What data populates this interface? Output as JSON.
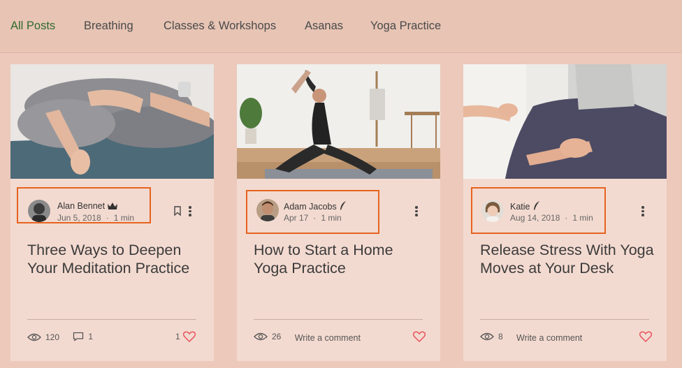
{
  "nav": {
    "tabs": [
      {
        "label": "All Posts",
        "active": true
      },
      {
        "label": "Breathing"
      },
      {
        "label": "Classes & Workshops"
      },
      {
        "label": "Asanas"
      },
      {
        "label": "Yoga Practice"
      }
    ]
  },
  "colors": {
    "accent_active_tab": "#2f6b2f",
    "highlight_box": "#e6631f",
    "heart": "#e8515b",
    "card_bg": "#f3dad0"
  },
  "posts": [
    {
      "author": "Alan Bennet",
      "role_icon": "crown-icon",
      "date": "Jun 5, 2018",
      "read_time": "1 min",
      "title": "Three Ways to Deepen Your Meditation Practice",
      "views": "120",
      "comments": "1",
      "likes": "1",
      "liked": true
    },
    {
      "author": "Adam Jacobs",
      "role_icon": "feather-icon",
      "date": "Apr 17",
      "read_time": "1 min",
      "title": "How to Start a Home Yoga Practice",
      "views": "26",
      "comment_prompt": "Write a comment"
    },
    {
      "author": "Katie",
      "role_icon": "feather-icon",
      "date": "Aug 14, 2018",
      "read_time": "1 min",
      "title": "Release Stress With Yoga Moves at Your Desk",
      "views": "8",
      "comment_prompt": "Write a comment"
    }
  ]
}
